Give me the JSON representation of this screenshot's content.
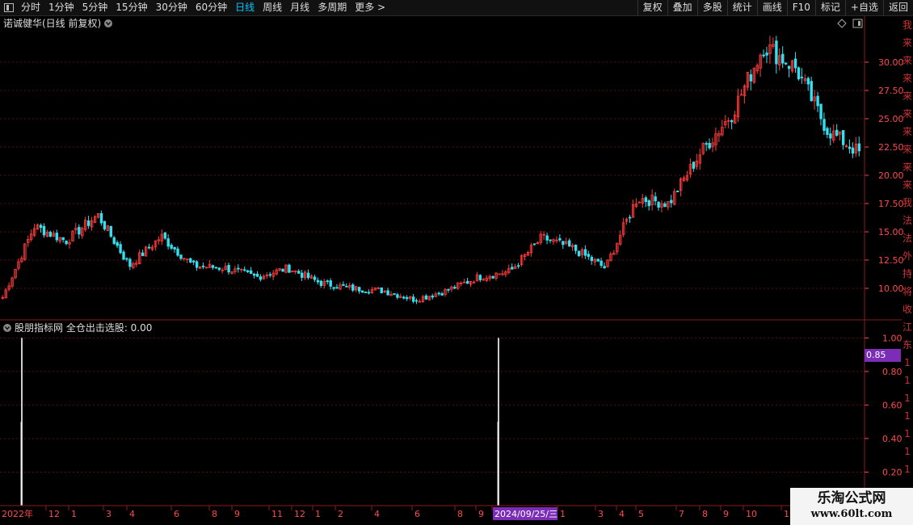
{
  "toolbar": {
    "periods": [
      "分时",
      "1分钟",
      "5分钟",
      "15分钟",
      "30分钟",
      "60分钟",
      "日线",
      "周线",
      "月线",
      "多周期",
      "更多 >"
    ],
    "active_period": "日线",
    "actions": [
      "复权",
      "叠加",
      "多股",
      "统计",
      "画线",
      "F10",
      "标记",
      "+自选",
      "返回"
    ]
  },
  "main_chart": {
    "title": "诺诚健华(日线 前复权)",
    "y_ticks": [
      "30.00",
      "27.50",
      "25.00",
      "22.50",
      "20.00",
      "17.50",
      "15.00",
      "12.50",
      "10.00"
    ]
  },
  "indicator": {
    "title": "股朋指标网 全仓出击选股: 0.00",
    "y_ticks": [
      "1.00",
      "0.80",
      "0.60",
      "0.40",
      "0.20"
    ],
    "current_value": "0.85"
  },
  "x_axis": {
    "labels": [
      "2022年",
      "12",
      "1",
      "3",
      "4",
      "6",
      "8",
      "9",
      "11",
      "12",
      "1",
      "2",
      "4",
      "6",
      "8",
      "9",
      "2024/09/25/三",
      "1",
      "3",
      "4",
      "5",
      "7",
      "8",
      "9",
      "10",
      "1"
    ],
    "highlight": "2024/09/25/三"
  },
  "side_column": [
    "我",
    "来",
    "来",
    "来",
    "来",
    "来",
    "来",
    "来",
    "来",
    "来",
    "我",
    "法",
    "法",
    "外",
    "持",
    "将",
    "收",
    "江",
    "东",
    "1",
    "1",
    "1",
    "1",
    "1",
    "1",
    "1"
  ],
  "watermark": {
    "title": "乐淘公式网",
    "url": "www.60lt.com"
  },
  "colors": {
    "up": "#ff3b3b",
    "down": "#33e0f0",
    "grid": "#5a0f0f",
    "axis_text": "#ff4a4a",
    "highlight": "#7b2db8"
  },
  "chart_data": [
    {
      "type": "line",
      "title": "诺诚健华(日线 前复权)",
      "note_type": "candlestick (drawn as OHLC bars)",
      "x": [
        "2022-11",
        "2022-12",
        "2023-01",
        "2023-03",
        "2023-04",
        "2023-06",
        "2023-08",
        "2023-09",
        "2023-11",
        "2023-12",
        "2024-01",
        "2024-02",
        "2024-04",
        "2024-06",
        "2024-08",
        "2024-09",
        "2024-09-25",
        "2024-10",
        "2024-11",
        "2025-01",
        "2025-03",
        "2025-04",
        "2025-05",
        "2025-07",
        "2025-08",
        "2025-09",
        "2025-10",
        "2026-01"
      ],
      "series": [
        {
          "values": [
            9.2,
            15.5,
            14.2,
            16.5,
            12.0,
            14.6,
            12.0,
            11.8,
            11.0,
            11.8,
            10.5,
            10.0,
            9.8,
            9.0,
            9.8,
            11.0,
            11.5,
            14.5,
            13.5,
            11.8,
            18.0,
            17.5,
            22.0,
            25.5,
            31.5,
            29.5,
            24.0,
            22.0
          ]
        }
      ],
      "ylim": [
        7.5,
        32.5
      ],
      "yticks": [
        10,
        12.5,
        15,
        17.5,
        20,
        22.5,
        25,
        27.5,
        30
      ]
    },
    {
      "type": "bar",
      "title": "股朋指标网 全仓出击选股: 0.00",
      "x": [
        "2022-11-early",
        "2024-09-24"
      ],
      "values": [
        1.0,
        1.0
      ],
      "ylim": [
        0,
        1.05
      ],
      "yticks": [
        0.2,
        0.4,
        0.6,
        0.8,
        1.0
      ]
    }
  ]
}
